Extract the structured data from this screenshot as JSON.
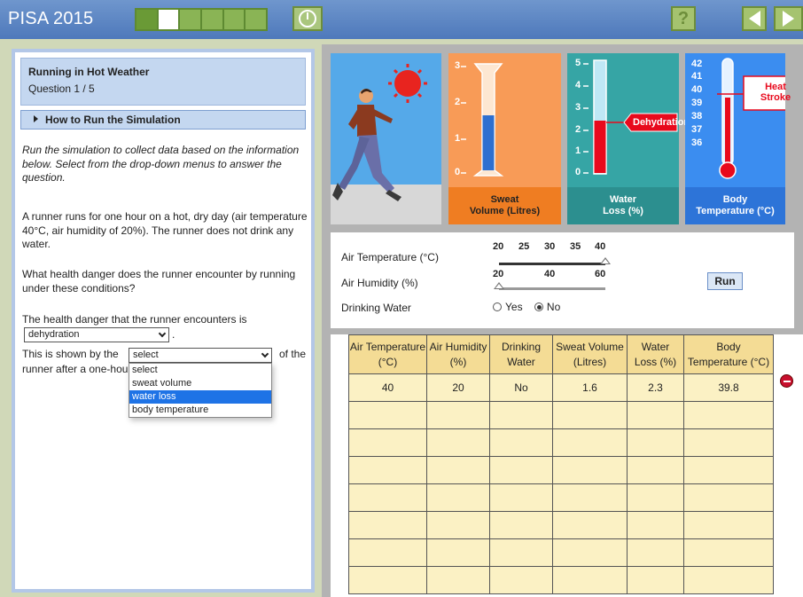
{
  "app": {
    "title": "PISA 2015",
    "progress": {
      "total_segments": 6,
      "current_segment": 2
    }
  },
  "nav": {
    "help_label": "?",
    "timer_icon": "clock-icon",
    "back_icon": "triangle-left-icon",
    "next_icon": "triangle-right-icon"
  },
  "question": {
    "title": "Running in Hot Weather",
    "number": "Question 1 / 5",
    "howto_label": "How to Run the Simulation",
    "instructions": "Run the simulation to collect data based on the information below. Select from the drop-down menus to answer the question.",
    "scenario": "A runner runs for one hour on a hot, dry day (air temperature 40°C, air humidity of 20%). The runner does not drink any water.",
    "question_text": "What health danger does the runner encounter by running under these conditions?",
    "answer_stem": "The health danger that the runner encounters is",
    "select1_value": "dehydration",
    "period": ".",
    "shown_before": "This is shown by the",
    "select2_value": "select",
    "shown_after": "of the",
    "runner_after": "runner after a one-hour",
    "dropdown_options": [
      "select",
      "sweat volume",
      "water loss",
      "body temperature"
    ],
    "dropdown_highlighted": 2
  },
  "visuals": {
    "sweat": {
      "label_line1": "Sweat",
      "label_line2": "Volume (Litres)",
      "ticks": [
        "3",
        "2",
        "1",
        "0"
      ],
      "value": 1.6,
      "max": 3
    },
    "water": {
      "label_line1": "Water",
      "label_line2": "Loss (%)",
      "ticks": [
        "5",
        "4",
        "3",
        "2",
        "1",
        "0"
      ],
      "value": 2.3,
      "max": 5,
      "callout": "Dehydration"
    },
    "temp": {
      "label_line1": "Body",
      "label_line2": "Temperature (°C)",
      "ticks": [
        "42",
        "41",
        "40",
        "39",
        "38",
        "37",
        "36"
      ],
      "callout_line1": "Heat",
      "callout_line2": "Stroke"
    },
    "colors": {
      "sweat": "#f89b57",
      "water": "#36a5a5",
      "temp": "#3b8df0",
      "sky": "#55a9e9"
    }
  },
  "controls": {
    "air_temp_label": "Air Temperature (°C)",
    "air_temp_scale": [
      "20",
      "25",
      "30",
      "35",
      "40"
    ],
    "air_temp_value": 40,
    "humidity_label": "Air Humidity (%)",
    "humidity_scale": [
      "20",
      "40",
      "60"
    ],
    "humidity_value": 20,
    "drinking_label": "Drinking Water",
    "yes_label": "Yes",
    "no_label": "No",
    "drinking_value": "No",
    "run_label": "Run"
  },
  "table": {
    "headers": [
      [
        "Air Temperature",
        "(°C)"
      ],
      [
        "Air Humidity",
        "(%)"
      ],
      [
        "Drinking",
        "Water"
      ],
      [
        "Sweat Volume",
        "(Litres)"
      ],
      [
        "Water",
        "Loss (%)"
      ],
      [
        "Body",
        "Temperature (°C)"
      ]
    ],
    "rows": [
      [
        "40",
        "20",
        "No",
        "1.6",
        "2.3",
        "39.8"
      ]
    ],
    "empty_rows": 7
  }
}
